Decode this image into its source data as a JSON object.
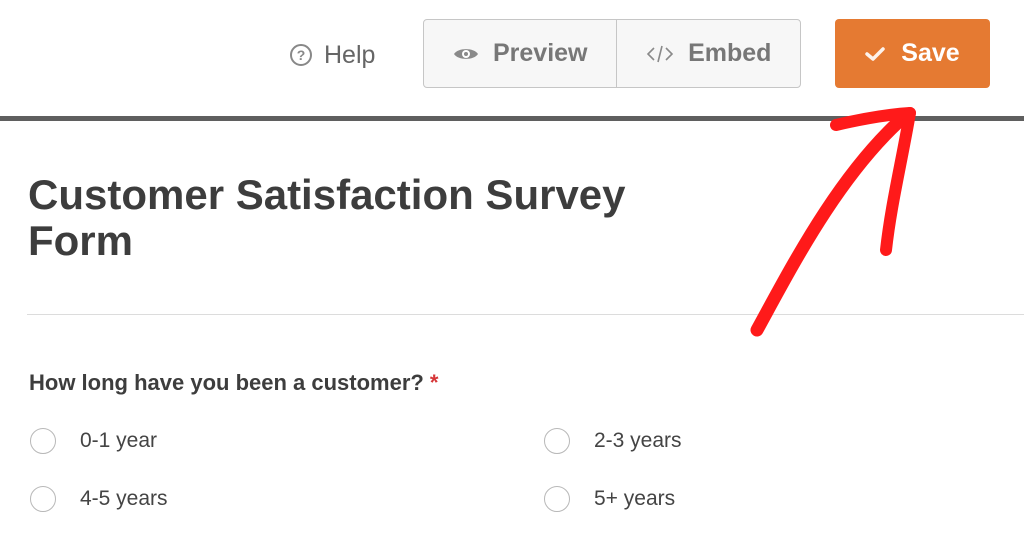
{
  "toolbar": {
    "help_label": "Help",
    "preview_label": "Preview",
    "embed_label": "Embed",
    "save_label": "Save"
  },
  "icons": {
    "help": "question-circle-icon",
    "preview": "eye-icon",
    "embed": "code-icon",
    "save": "checkmark-icon"
  },
  "colors": {
    "save_button": "#e57a32",
    "required_marker": "#d63638",
    "annotation_arrow": "#ff1a1a"
  },
  "form": {
    "title": "Customer Satisfaction Survey Form",
    "question": {
      "label": "How long have you been a customer?",
      "required_marker": "*",
      "options": [
        "0-1 year",
        "2-3 years",
        "4-5 years",
        "5+ years"
      ]
    }
  }
}
